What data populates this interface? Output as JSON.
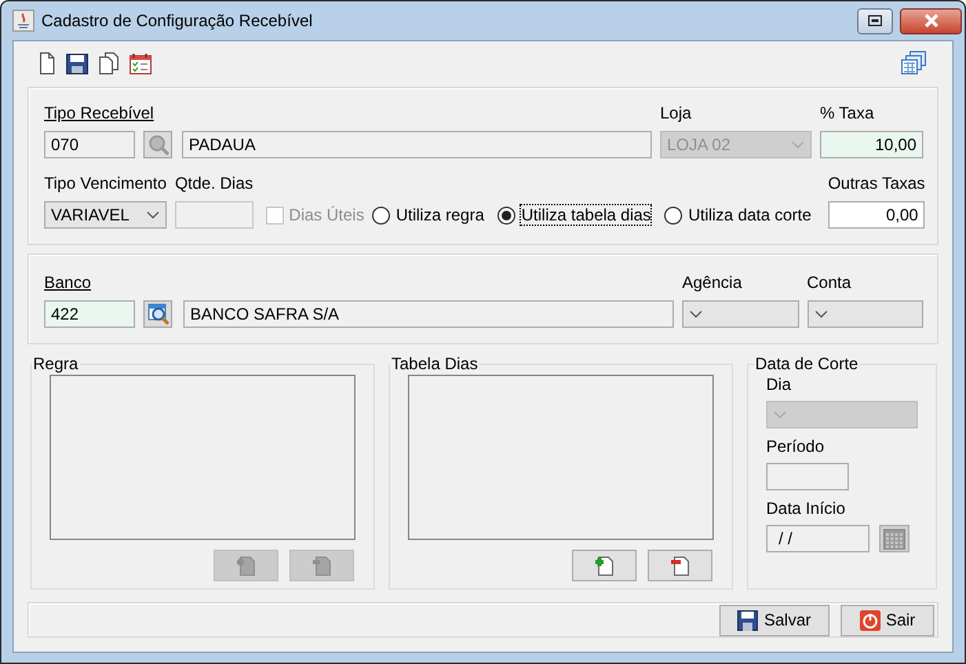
{
  "window": {
    "title": "Cadastro de Configuração Recebível"
  },
  "tipo_recebivel": {
    "label": "Tipo Recebível",
    "code": "070",
    "name": "PADAUA"
  },
  "loja": {
    "label": "Loja",
    "value": "LOJA 02",
    "disabled": true
  },
  "taxa": {
    "label": "% Taxa",
    "value": "10,00"
  },
  "tipo_vencimento": {
    "label": "Tipo Vencimento",
    "value": "VARIAVEL"
  },
  "qtde_dias": {
    "label": "Qtde. Dias",
    "disabled": true
  },
  "dias_uteis": {
    "label": "Dias Úteis",
    "checked": false,
    "disabled": true
  },
  "regra_options": [
    {
      "label": "Utiliza regra",
      "selected": false
    },
    {
      "label": "Utiliza tabela dias",
      "selected": true
    },
    {
      "label": "Utiliza data corte",
      "selected": false
    }
  ],
  "outras_taxas": {
    "label": "Outras Taxas",
    "value": "0,00"
  },
  "banco": {
    "label": "Banco",
    "code": "422",
    "name": "BANCO SAFRA S/A"
  },
  "agencia": {
    "label": "Agência"
  },
  "conta": {
    "label": "Conta"
  },
  "regra": {
    "title": "Regra",
    "disabled": true
  },
  "tabela_dias": {
    "title": "Tabela Dias",
    "disabled": false
  },
  "data_corte": {
    "title": "Data de Corte",
    "dia_label": "Dia",
    "dia_disabled": true,
    "periodo_label": "Período",
    "data_inicio_label": "Data Início",
    "data_inicio": "/ /"
  },
  "buttons": [
    {
      "label": "Salvar",
      "kind": "save"
    },
    {
      "label": "Sair",
      "kind": "exit"
    }
  ]
}
